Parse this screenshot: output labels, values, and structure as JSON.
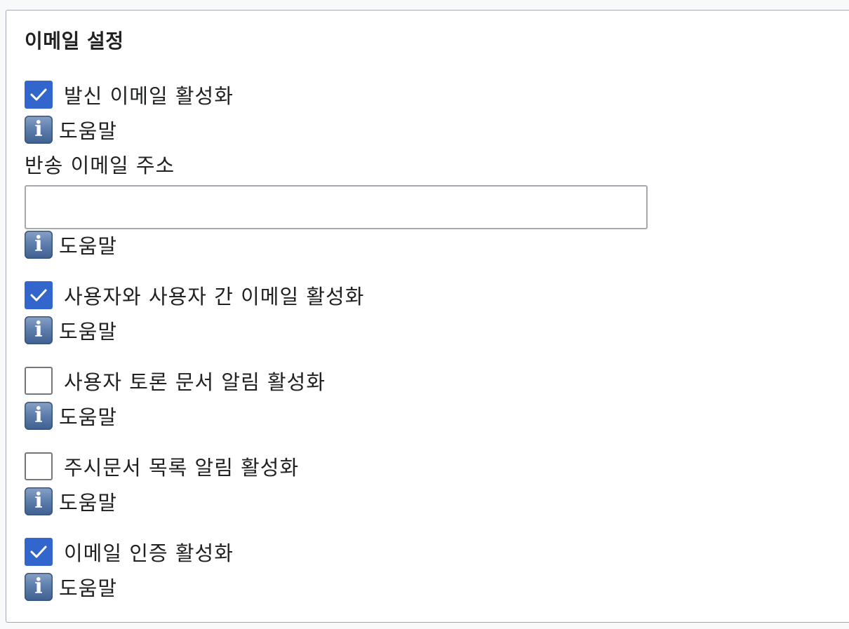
{
  "section": {
    "title": "이메일 설정"
  },
  "settings": {
    "outgoing_email": {
      "label": "발신 이메일 활성화",
      "checked": true,
      "help": "도움말"
    },
    "bounce_address": {
      "label": "반송 이메일 주소",
      "value": "",
      "placeholder": "",
      "help": "도움말"
    },
    "user_email": {
      "label": "사용자와 사용자 간 이메일 활성화",
      "checked": true,
      "help": "도움말"
    },
    "user_talk_notify": {
      "label": "사용자 토론 문서 알림 활성화",
      "checked": false,
      "help": "도움말"
    },
    "watchlist_notify": {
      "label": "주시문서 목록 알림 활성화",
      "checked": false,
      "help": "도움말"
    },
    "email_auth": {
      "label": "이메일 인증 활성화",
      "checked": true,
      "help": "도움말"
    }
  },
  "icons": {
    "info": "info-icon",
    "check": "checkmark-icon"
  },
  "colors": {
    "accent": "#3366cc",
    "border": "#a2a9b1",
    "text": "#202122"
  }
}
